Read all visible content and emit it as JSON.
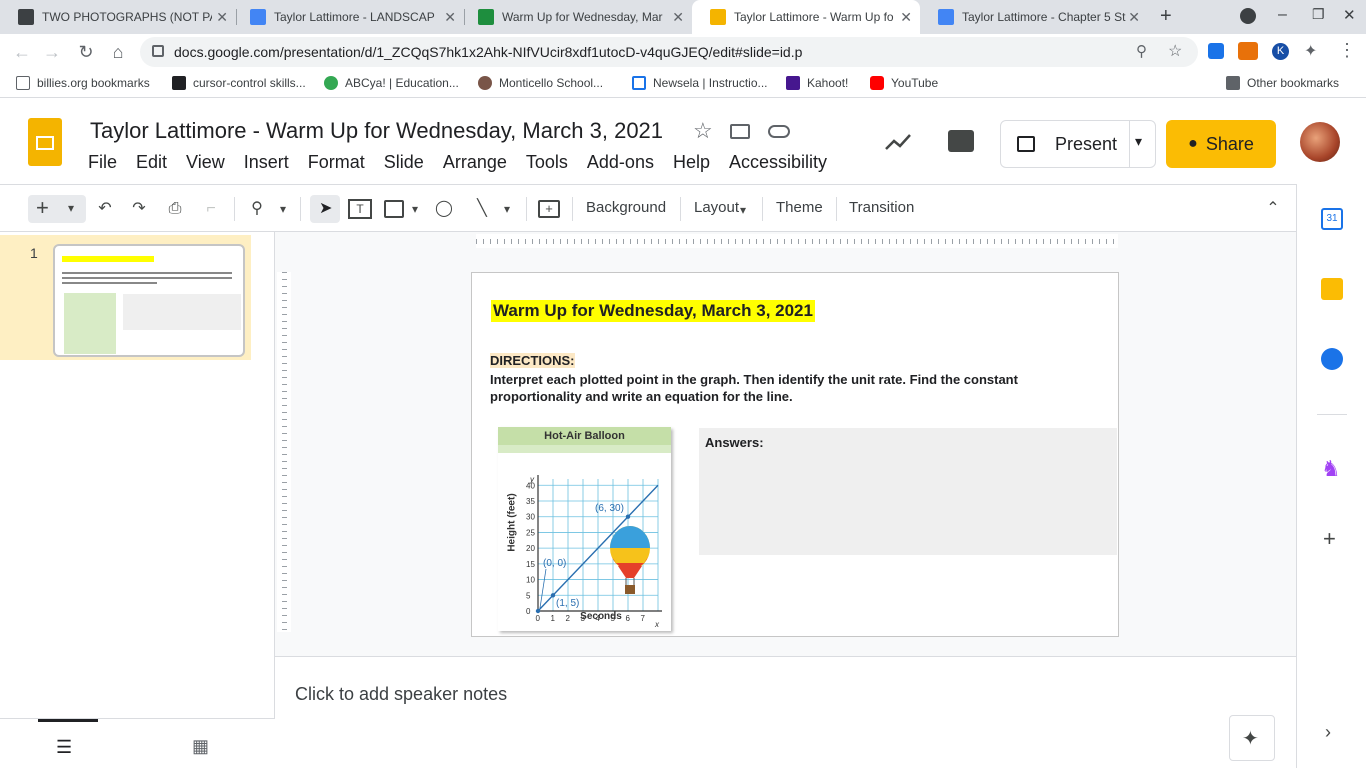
{
  "browser": {
    "tabs": [
      {
        "title": "TWO PHOTOGRAPHS (NOT PA",
        "icon": "photo-tab-icon"
      },
      {
        "title": "Taylor Lattimore - LANDSCAP",
        "icon": "docs-icon"
      },
      {
        "title": "Warm Up for Wednesday, Mar",
        "icon": "classroom-icon"
      },
      {
        "title": "Taylor Lattimore - Warm Up fo",
        "icon": "slides-icon"
      },
      {
        "title": "Taylor Lattimore - Chapter 5 St",
        "icon": "docs-icon"
      }
    ],
    "url": "docs.google.com/presentation/d/1_ZCQqS7hk1x2Ahk-NIfVUcir8xdf1utocD-v4quGJEQ/edit#slide=id.p",
    "bookmarks": [
      "billies.org bookmarks",
      "cursor-control skills...",
      "ABCya! | Education...",
      "Monticello School...",
      "Newsela | Instructio...",
      "Kahoot!",
      "YouTube"
    ],
    "other_bookmarks": "Other bookmarks"
  },
  "app": {
    "title": "Taylor Lattimore - Warm Up for Wednesday, March 3, 2021",
    "menu": [
      "File",
      "Edit",
      "View",
      "Insert",
      "Format",
      "Slide",
      "Arrange",
      "Tools",
      "Add-ons",
      "Help",
      "Accessibility"
    ],
    "present_label": "Present",
    "share_label": "Share"
  },
  "toolbar": {
    "background_label": "Background",
    "layout_label": "Layout",
    "theme_label": "Theme",
    "transition_label": "Transition"
  },
  "filmstrip": {
    "slide_number": "1"
  },
  "slide": {
    "title": "Warm Up for Wednesday, March 3, 2021",
    "directions_label": "DIRECTIONS:",
    "directions_text": "Interpret each plotted point in the graph.  Then identify the unit rate.  Find the constant proportionality and write an equation for the line.",
    "answers_label": "Answers:",
    "graph": {
      "title": "Hot-Air Balloon",
      "xlabel": "Seconds",
      "ylabel": "Height (feet)",
      "x_axis_letter": "x",
      "y_axis_letter": "y",
      "point_labels": [
        "(0, 0)",
        "(1, 5)",
        "(6, 30)"
      ],
      "x_ticks": [
        "0",
        "1",
        "2",
        "3",
        "4",
        "5",
        "6",
        "7"
      ],
      "y_ticks": [
        "0",
        "5",
        "10",
        "15",
        "20",
        "25",
        "30",
        "35",
        "40"
      ]
    }
  },
  "chart_data": {
    "type": "line",
    "title": "Hot-Air Balloon",
    "xlabel": "Seconds",
    "ylabel": "Height (feet)",
    "x": [
      0,
      1,
      6
    ],
    "y": [
      0,
      5,
      30
    ],
    "xlim": [
      0,
      8
    ],
    "ylim": [
      0,
      42
    ],
    "grid": true
  },
  "notes": {
    "placeholder": "Click to add speaker notes"
  },
  "colors": {
    "share": "#fbbc04",
    "highlight": "#ffff00",
    "selected_thumb": "#feefc3"
  }
}
